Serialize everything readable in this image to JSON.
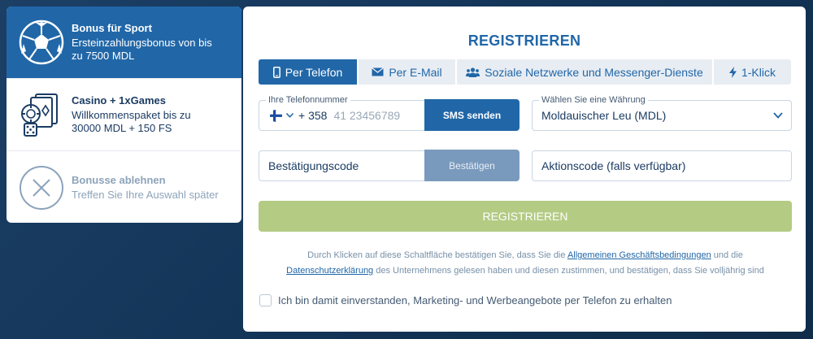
{
  "bonuses": [
    {
      "title": "Bonus für Sport",
      "desc1": "Ersteinzahlungsbonus von bis",
      "desc2": "zu 7500 MDL",
      "icon": "soccer-ball-icon",
      "state": "active"
    },
    {
      "title": "Casino + 1xGames",
      "desc1": "Willkommenspaket bis zu",
      "desc2": "30000 MDL + 150 FS",
      "icon": "casino-chip-cards-icon",
      "state": "normal"
    },
    {
      "title": "Bonusse ablehnen",
      "desc1": "Treffen Sie Ihre Auswahl später",
      "icon": "decline-x-icon",
      "state": "muted"
    }
  ],
  "registration": {
    "title": "REGISTRIEREN",
    "tabs": [
      {
        "label": "Per Telefon",
        "icon": "phone-icon",
        "active": true
      },
      {
        "label": "Per E-Mail",
        "icon": "envelope-icon",
        "active": false
      },
      {
        "label": "Soziale Netzwerke und Messenger-Dienste",
        "icon": "users-icon",
        "active": false
      },
      {
        "label": "1-Klick",
        "icon": "lightning-icon",
        "active": false
      }
    ],
    "phone": {
      "label": "Ihre Telefonnummer",
      "country_code": "+ 358",
      "placeholder": "41 23456789",
      "flag": "finland-flag-icon"
    },
    "sms_button": "SMS senden",
    "currency": {
      "label": "Wählen Sie eine Währung",
      "value": "Moldauischer Leu (MDL)"
    },
    "confirmation_code": {
      "placeholder": "Bestätigungscode",
      "button": "Bestätigen"
    },
    "promo_code": {
      "placeholder": "Aktionscode (falls verfügbar)"
    },
    "submit_button": "REGISTRIEREN",
    "legal": {
      "part1": "Durch Klicken auf diese Schaltfläche bestätigen Sie, dass Sie die ",
      "terms_link": "Allgemeinen Geschäftsbedingungen",
      "part2": " und die",
      "privacy_link": "Datenschutzerklärung",
      "part3": " des Unternehmens gelesen haben und diesen zustimmen, und bestätigen, dass Sie volljährig sind"
    },
    "marketing_consent": "Ich bin damit einverstanden, Marketing- und Werbeangebote per Telefon zu erhalten"
  },
  "colors": {
    "primary": "#2167a8",
    "submit_disabled": "#b4cb84",
    "confirm_disabled": "#7a9abd",
    "background": "#123456"
  }
}
